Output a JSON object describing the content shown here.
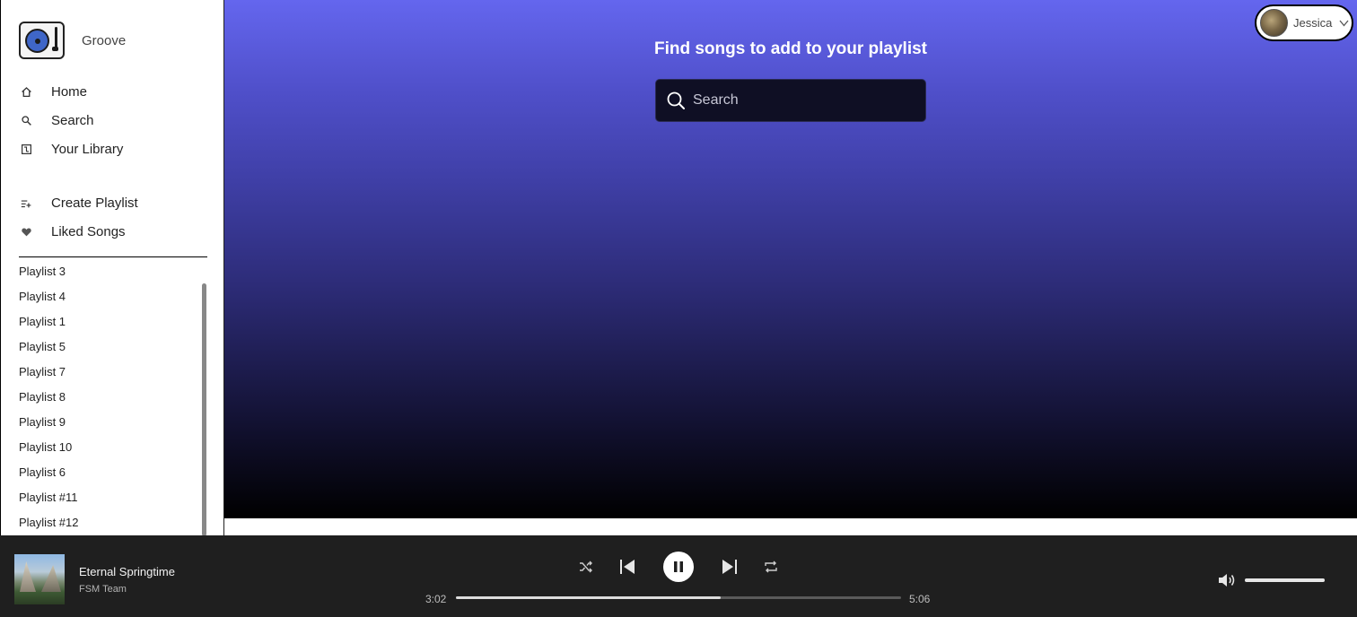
{
  "app": {
    "name": "Groove"
  },
  "nav": {
    "home": "Home",
    "search": "Search",
    "library": "Your Library",
    "create_playlist": "Create Playlist",
    "liked_songs": "Liked Songs"
  },
  "playlists": [
    "Playlist 3",
    "Playlist 4",
    "Playlist 1",
    "Playlist 5",
    "Playlist 7",
    "Playlist 8",
    "Playlist 9",
    "Playlist 10",
    "Playlist 6",
    "Playlist #11",
    "Playlist #12"
  ],
  "main": {
    "title": "Find songs to add to your playlist",
    "search_placeholder": "Search"
  },
  "user": {
    "name": "Jessica"
  },
  "player": {
    "track_title": "Eternal Springtime",
    "artist": "FSM Team",
    "elapsed": "3:02",
    "duration": "5:06",
    "progress_fraction": 0.595,
    "volume_fraction": 1.0
  },
  "colors": {
    "gradient_top": "#6466ee",
    "gradient_bottom": "#000000",
    "player_bg": "#1f1f1f",
    "search_bg": "#0f0f24"
  },
  "icons": {
    "home": "home-icon",
    "search": "search-icon",
    "library": "library-icon",
    "create_playlist": "add-playlist-icon",
    "liked_songs": "heart-icon",
    "shuffle": "shuffle-icon",
    "previous": "skip-back-icon",
    "pause": "pause-icon",
    "next": "skip-forward-icon",
    "repeat": "repeat-icon",
    "volume": "volume-icon",
    "caret": "chevron-down-icon"
  }
}
